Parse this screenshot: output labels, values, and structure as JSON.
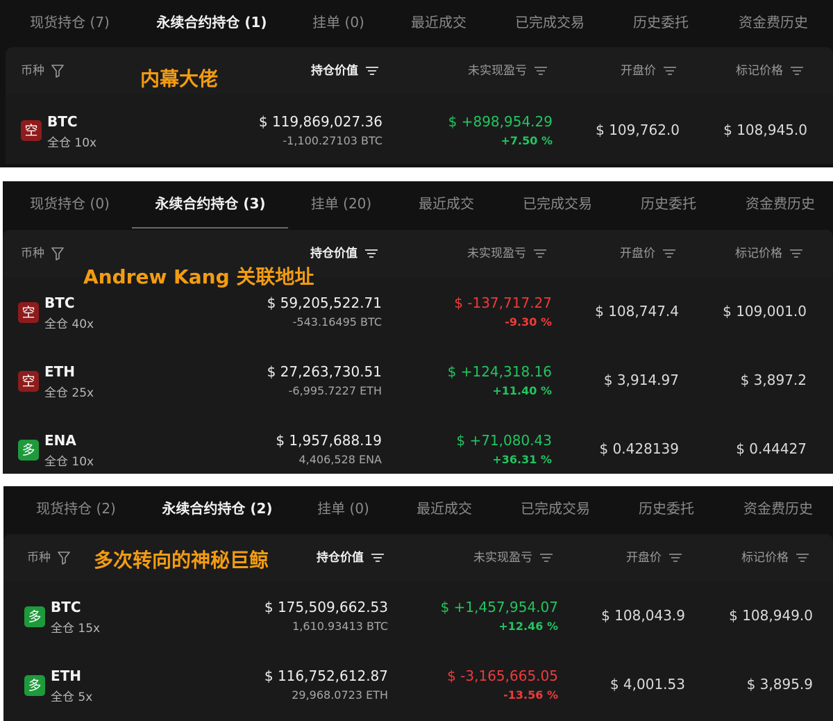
{
  "colors": {
    "profit": "#22c55e",
    "loss": "#ef3b3b",
    "short_badge": "#8e1c1c",
    "long_badge": "#1e9a3c",
    "annotation": "#f39c12"
  },
  "headers": {
    "coin": "币种",
    "position_value": "持仓价值",
    "unrealized_pnl": "未实现盈亏",
    "entry_price": "开盘价",
    "mark_price": "标记价格",
    "filter_icon": "filter-icon",
    "sort_icon": "sort-icon"
  },
  "panels": [
    {
      "annotation": "内幕大佬",
      "tabs": [
        "现货持仓 (7)",
        "永续合约持仓 (1)",
        "挂单 (0)",
        "最近成交",
        "已完成交易",
        "历史委托",
        "资金费历史"
      ],
      "active_tab": "永续合约持仓 (1)",
      "rows": [
        {
          "side": "空",
          "symbol": "BTC",
          "margin": "全仓 10x",
          "value": "$ 119,869,027.36",
          "qty": "-1,100.27103 BTC",
          "pnl": "$ +898,954.29",
          "pnl_pct": "+7.50 %",
          "entry": "$ 109,762.0",
          "mark": "$ 108,945.0"
        }
      ]
    },
    {
      "annotation": "Andrew Kang 关联地址",
      "tabs": [
        "现货持仓 (0)",
        "永续合约持仓 (3)",
        "挂单 (20)",
        "最近成交",
        "已完成交易",
        "历史委托",
        "资金费历史"
      ],
      "active_tab": "永续合约持仓 (3)",
      "rows": [
        {
          "side": "空",
          "symbol": "BTC",
          "margin": "全仓 40x",
          "value": "$ 59,205,522.71",
          "qty": "-543.16495 BTC",
          "pnl": "$ -137,717.27",
          "pnl_pct": "-9.30 %",
          "entry": "$ 108,747.4",
          "mark": "$ 109,001.0"
        },
        {
          "side": "空",
          "symbol": "ETH",
          "margin": "全仓 25x",
          "value": "$ 27,263,730.51",
          "qty": "-6,995.7227 ETH",
          "pnl": "$ +124,318.16",
          "pnl_pct": "+11.40 %",
          "entry": "$ 3,914.97",
          "mark": "$ 3,897.2"
        },
        {
          "side": "多",
          "symbol": "ENA",
          "margin": "全仓 10x",
          "value": "$ 1,957,688.19",
          "qty": "4,406,528 ENA",
          "pnl": "$ +71,080.43",
          "pnl_pct": "+36.31 %",
          "entry": "$ 0.428139",
          "mark": "$ 0.44427"
        }
      ]
    },
    {
      "annotation": "多次转向的神秘巨鲸",
      "tabs": [
        "现货持仓 (2)",
        "永续合约持仓 (2)",
        "挂单 (0)",
        "最近成交",
        "已完成交易",
        "历史委托",
        "资金费历史"
      ],
      "active_tab": "永续合约持仓 (2)",
      "rows": [
        {
          "side": "多",
          "symbol": "BTC",
          "margin": "全仓 15x",
          "value": "$ 175,509,662.53",
          "qty": "1,610.93413 BTC",
          "pnl": "$ +1,457,954.07",
          "pnl_pct": "+12.46 %",
          "entry": "$ 108,043.9",
          "mark": "$ 108,949.0"
        },
        {
          "side": "多",
          "symbol": "ETH",
          "margin": "全仓 5x",
          "value": "$ 116,752,612.87",
          "qty": "29,968.0723 ETH",
          "pnl": "$ -3,165,665.05",
          "pnl_pct": "-13.56 %",
          "entry": "$ 4,001.53",
          "mark": "$ 3,895.9"
        }
      ]
    }
  ]
}
